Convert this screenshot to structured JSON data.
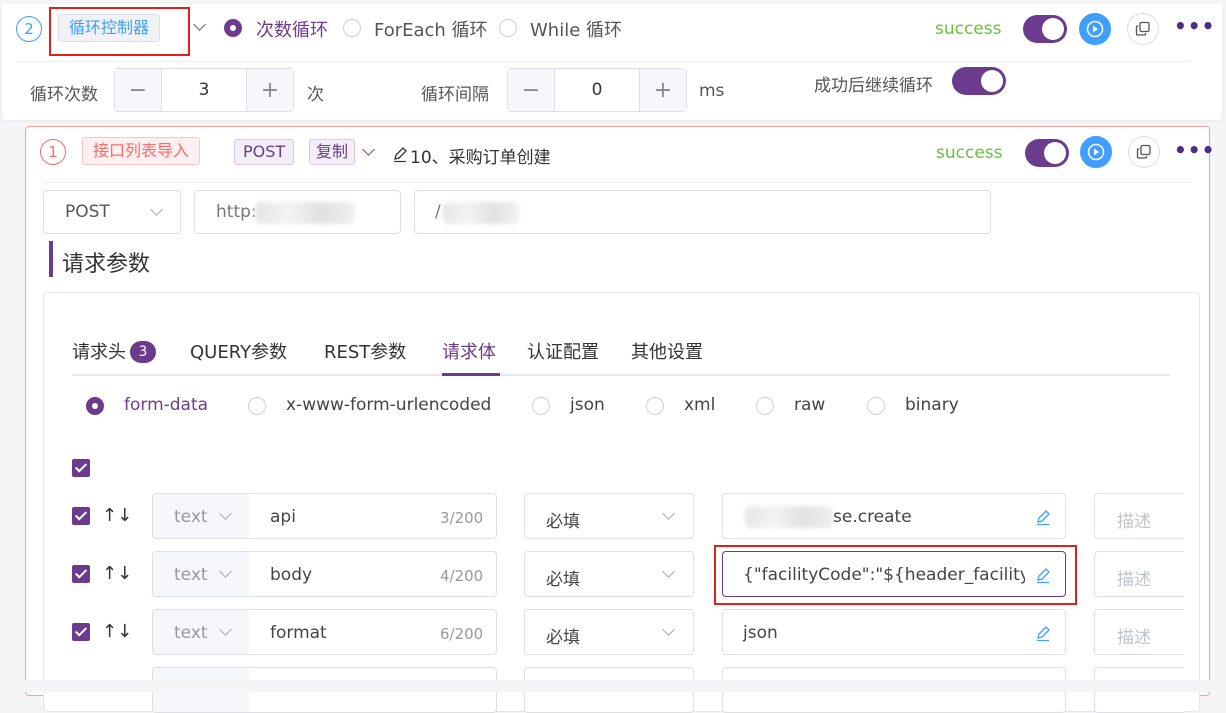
{
  "loop_card": {
    "index": "2",
    "controller_label": "循环控制器",
    "mode_options": [
      "次数循环",
      "ForEach 循环",
      "While 循环"
    ],
    "selected_mode": "次数循环",
    "status": "success",
    "count_label": "循环次数",
    "count_value": "3",
    "count_unit": "次",
    "interval_label": "循环间隔",
    "interval_value": "0",
    "interval_unit": "ms",
    "continue_label": "成功后继续循环",
    "minus": "−",
    "plus": "+"
  },
  "api_card": {
    "index": "1",
    "source_tag": "接口列表导入",
    "method_tag": "POST",
    "copy_tag": "复制",
    "name": "10、采购订单创建",
    "status": "success",
    "method_select": "POST",
    "url_prefix": "http:",
    "path_prefix": "/",
    "section_title": "请求参数"
  },
  "tabs": [
    {
      "label": "请求头",
      "badge": "3"
    },
    {
      "label": "QUERY参数"
    },
    {
      "label": "REST参数"
    },
    {
      "label": "请求体",
      "active": true
    },
    {
      "label": "认证配置"
    },
    {
      "label": "其他设置"
    }
  ],
  "body_types": [
    "form-data",
    "x-www-form-urlencoded",
    "json",
    "xml",
    "raw",
    "binary"
  ],
  "selected_body_type": "form-data",
  "params": [
    {
      "type": "text",
      "name": "api",
      "count": "3/200",
      "required": "必填",
      "value": "se.create",
      "desc_placeholder": "描述"
    },
    {
      "type": "text",
      "name": "body",
      "count": "4/200",
      "required": "必填",
      "value": "{\"facilityCode\":\"${header_facilityCoc",
      "desc_placeholder": "描述"
    },
    {
      "type": "text",
      "name": "format",
      "count": "6/200",
      "required": "必填",
      "value": "json",
      "desc_placeholder": "描述"
    }
  ],
  "colors": {
    "accent": "#6b3c8d",
    "success": "#67c23a",
    "primary": "#409eff",
    "highlight": "#e0201b"
  }
}
